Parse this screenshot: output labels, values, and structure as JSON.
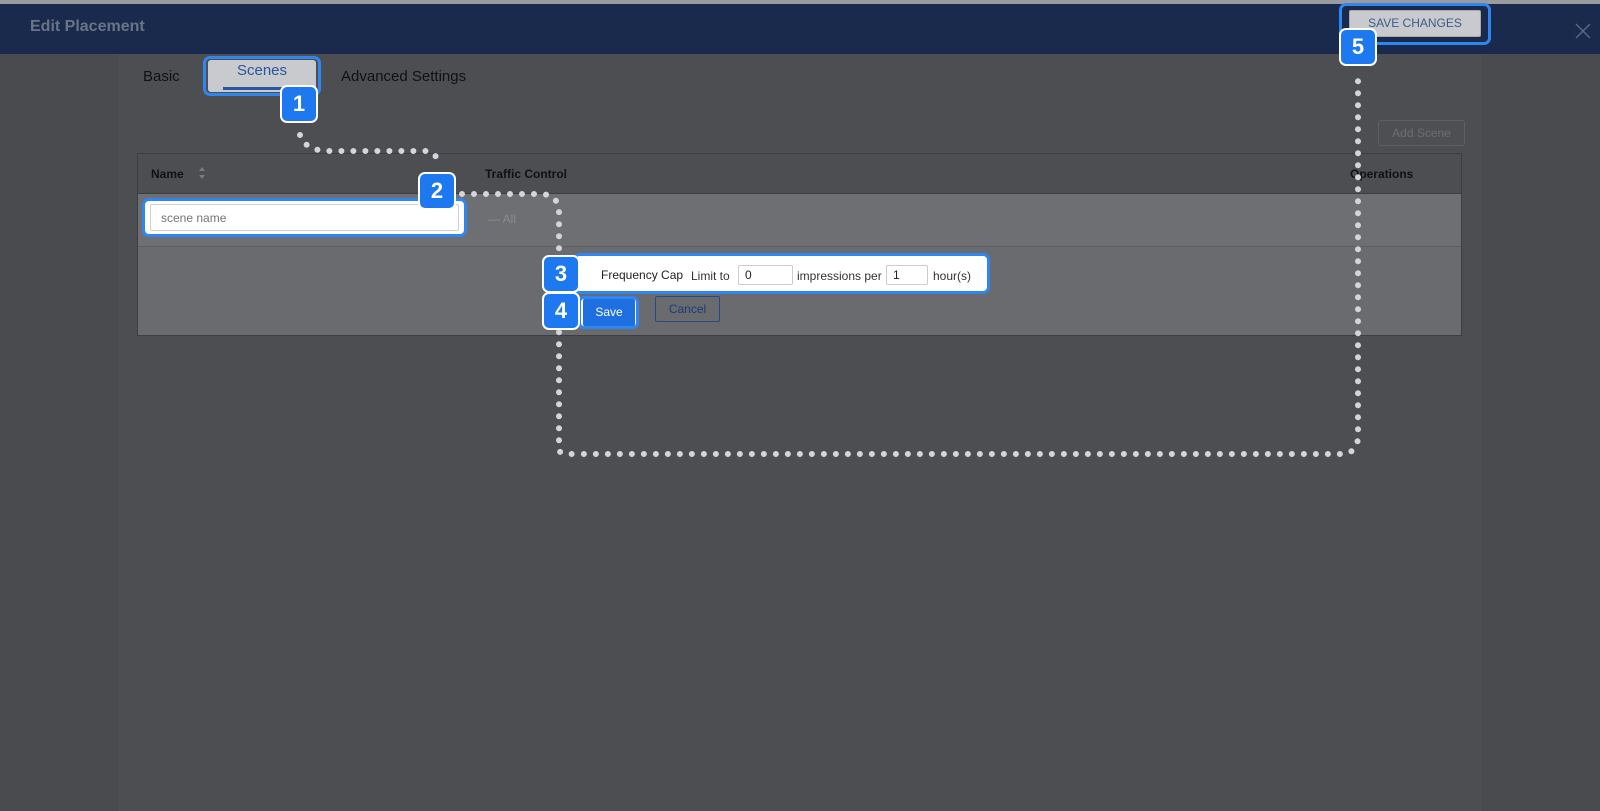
{
  "header": {
    "title": "Edit Placement",
    "save_changes_label": "SAVE CHANGES"
  },
  "tabs": [
    {
      "label": "Basic",
      "active": false
    },
    {
      "label": "Scenes",
      "active": true
    },
    {
      "label": "Advanced Settings",
      "active": false
    }
  ],
  "scenes": {
    "add_scene_label": "Add Scene",
    "columns": [
      "Name",
      "Traffic Control",
      "Operations"
    ],
    "row": {
      "name_placeholder": "scene name",
      "traffic_value": "All"
    },
    "frequency_cap": {
      "label": "Frequency Cap",
      "limit_prefix": "Limit to",
      "limit_value": "0",
      "impressions_per": "impressions per",
      "hours_value": "1",
      "hour_suffix": "hour(s)"
    },
    "save_label": "Save",
    "cancel_label": "Cancel"
  },
  "steps": [
    "1",
    "2",
    "3",
    "4",
    "5"
  ],
  "colors": {
    "highlight": "#2f86f0",
    "badge": "#1e78ef",
    "header": "#192a4c",
    "primary_button": "#1e6fe0"
  }
}
